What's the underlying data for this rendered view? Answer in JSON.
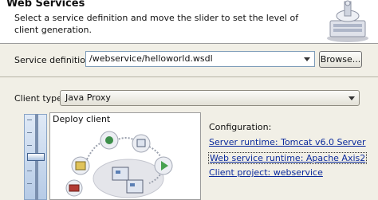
{
  "header": {
    "title": "Web Services",
    "description": "Select a service definition and move the slider to set the level of client generation."
  },
  "service": {
    "label": "Service definition:",
    "value": "/webservice/helloworld.wsdl",
    "browse_label": "Browse..."
  },
  "client": {
    "label": "Client type:",
    "value": "Java Proxy",
    "level_label": "Deploy client"
  },
  "config": {
    "heading": "Configuration:",
    "server_runtime": "Server runtime: Tomcat v6.0 Server",
    "ws_runtime": "Web service runtime: Apache Axis2",
    "client_project": "Client project: webservice"
  },
  "icons": [
    "web-services-header-icon",
    "dropdown-arrow-icon",
    "deploy-stage-icons"
  ],
  "colors": {
    "link": "#0b2a9c",
    "slider": "#b6cbe6",
    "header_bg": "#ffffff"
  }
}
